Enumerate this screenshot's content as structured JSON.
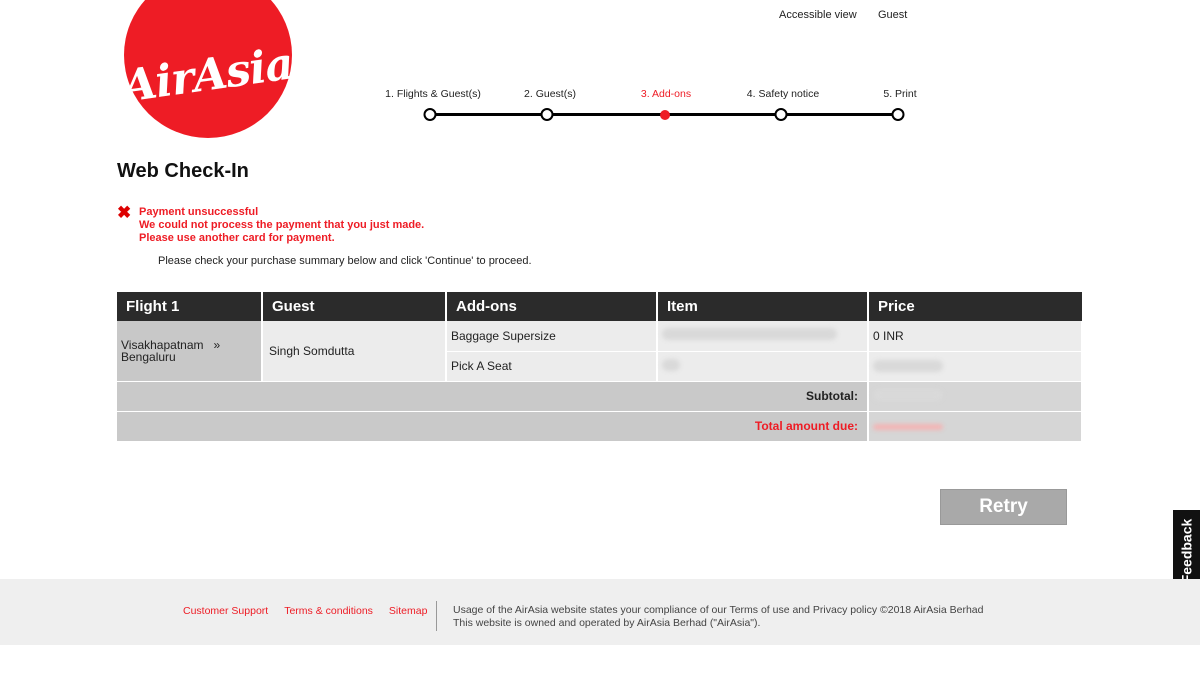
{
  "brand": {
    "logo_text": "AirAsia",
    "color": "#ee1c25"
  },
  "header": {
    "accessible_view": "Accessible view",
    "guest": "Guest"
  },
  "steps": [
    {
      "label": "1. Flights & Guest(s)",
      "active": false
    },
    {
      "label": "2. Guest(s)",
      "active": false
    },
    {
      "label": "3. Add-ons",
      "active": true
    },
    {
      "label": "4. Safety notice",
      "active": false
    },
    {
      "label": "5. Print",
      "active": false
    }
  ],
  "page_title": "Web Check-In",
  "error": {
    "icon": "close-icon",
    "line1": "Payment unsuccessful",
    "line2": "We could not process the payment that you just made.",
    "line3": "Please use another card for payment."
  },
  "instruction": "Please check your purchase summary below and click 'Continue' to proceed.",
  "summary": {
    "headers": [
      "Flight 1",
      "Guest",
      "Add-ons",
      "Item",
      "Price"
    ],
    "flight_from": "Visakhapatnam",
    "flight_arrow": "»",
    "flight_to": "Bengaluru",
    "guest_name": "Singh Somdutta",
    "addons": [
      {
        "name": "Baggage Supersize",
        "price": "0 INR"
      },
      {
        "name": "Pick A Seat",
        "price": ""
      }
    ],
    "subtotal_label": "Subtotal:",
    "total_label": "Total amount due:"
  },
  "retry_label": "Retry",
  "feedback_label": "Feedback",
  "footer": {
    "links": [
      "Customer Support",
      "Terms & conditions",
      "Sitemap"
    ],
    "legal_line1": "Usage of the AirAsia website states your compliance of our Terms of use and Privacy policy ©2018 AirAsia Berhad",
    "legal_line2": "This website is owned and operated by AirAsia Berhad (\"AirAsia\")."
  }
}
